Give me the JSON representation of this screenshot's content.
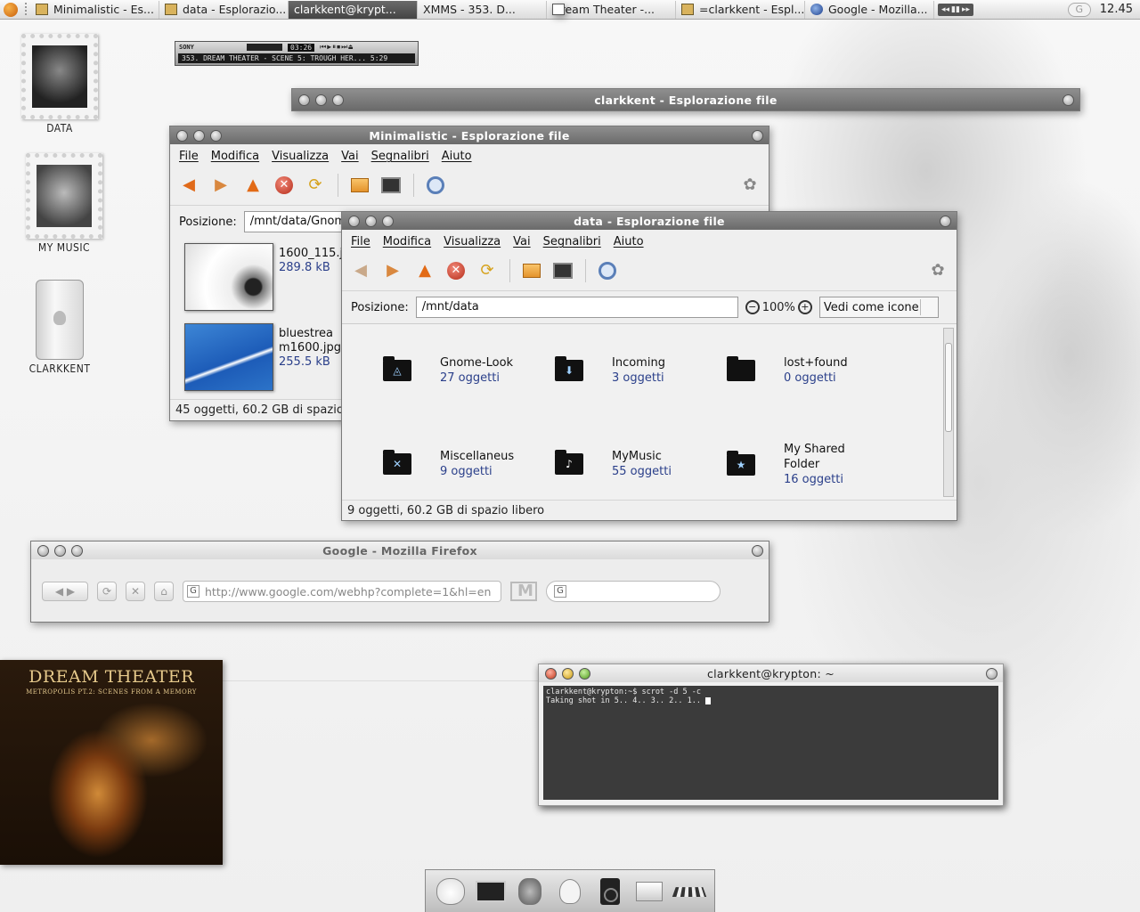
{
  "panel": {
    "tasks": [
      {
        "label": "Minimalistic - Es...",
        "icon": "folder-icon"
      },
      {
        "label": "data - Esplorazio...",
        "icon": "folder-icon"
      },
      {
        "label": "clarkkent@krypt...",
        "icon": "terminal-icon"
      },
      {
        "label": "XMMS - 353. D...",
        "icon": "xmms-icon"
      },
      {
        "label": "Dream Theater -...",
        "icon": "window-icon"
      },
      {
        "label": "=clarkkent - Espl...",
        "icon": "folder-icon"
      },
      {
        "label": "Google - Mozilla...",
        "icon": "firefox-icon"
      }
    ],
    "xmms_controls": [
      "◂◂",
      "▮▮",
      "▸▸"
    ],
    "clock": "12.45"
  },
  "desktop": {
    "icons": [
      {
        "label": "DATA"
      },
      {
        "label": "MY MUSIC"
      },
      {
        "label": "CLARKKENT"
      }
    ]
  },
  "xmms": {
    "brand": "SONY",
    "time": "03:26",
    "ticker": "353. DREAM THEATER - SCENE 5: TROUGH HER... 5:29"
  },
  "windows": {
    "clarkkent": {
      "title": "clarkkent - Esplorazione file"
    },
    "minimalistic": {
      "title": "Minimalistic - Esplorazione file",
      "menu": [
        "File",
        "Modifica",
        "Visualizza",
        "Vai",
        "Segnalibri",
        "Aiuto"
      ],
      "location_label": "Posizione:",
      "location_value": "/mnt/data/Gnome-Look/Wallpapers/Minimalistic",
      "files": [
        {
          "name": "1600_115.jpg",
          "size": "289.8 kB"
        },
        {
          "name": "bluestream1600.jpg",
          "size": "255.5 kB"
        }
      ],
      "status": "45 oggetti, 60.2 GB di spazio libero"
    },
    "data": {
      "title": "data - Esplorazione file",
      "menu": [
        "File",
        "Modifica",
        "Visualizza",
        "Vai",
        "Segnalibri",
        "Aiuto"
      ],
      "location_label": "Posizione:",
      "location_value": "/mnt/data",
      "zoom": "100%",
      "view_mode": "Vedi come icone",
      "folders": [
        {
          "name": "Gnome-Look",
          "count": "27 oggetti",
          "emblem": "gnome-emblem-icon"
        },
        {
          "name": "Incoming",
          "count": "3 oggetti",
          "emblem": "download-emblem-icon"
        },
        {
          "name": "lost+found",
          "count": "0 oggetti",
          "emblem": ""
        },
        {
          "name": "Miscellaneus",
          "count": "9 oggetti",
          "emblem": "misc-emblem-icon"
        },
        {
          "name": "MyMusic",
          "count": "55 oggetti",
          "emblem": "note-emblem-icon"
        },
        {
          "name": "My Shared Folder",
          "count": "16 oggetti",
          "emblem": "star-emblem-icon"
        }
      ],
      "status": "9 oggetti, 60.2 GB di spazio libero"
    },
    "firefox": {
      "title": "Google - Mozilla Firefox",
      "url": "http://www.google.com/webhp?complete=1&hl=en",
      "search_engine": "G"
    },
    "terminal": {
      "title": "clarkkent@krypton: ~",
      "lines": [
        "clarkkent@krypton:~$ scrot -d 5 -c",
        "Taking shot in 5.. 4.. 3.. 2.. 1.."
      ]
    }
  },
  "album": {
    "band": "DREAM THEATER",
    "subtitle": "METROPOLIS PT.2: SCENES FROM A MEMORY"
  }
}
